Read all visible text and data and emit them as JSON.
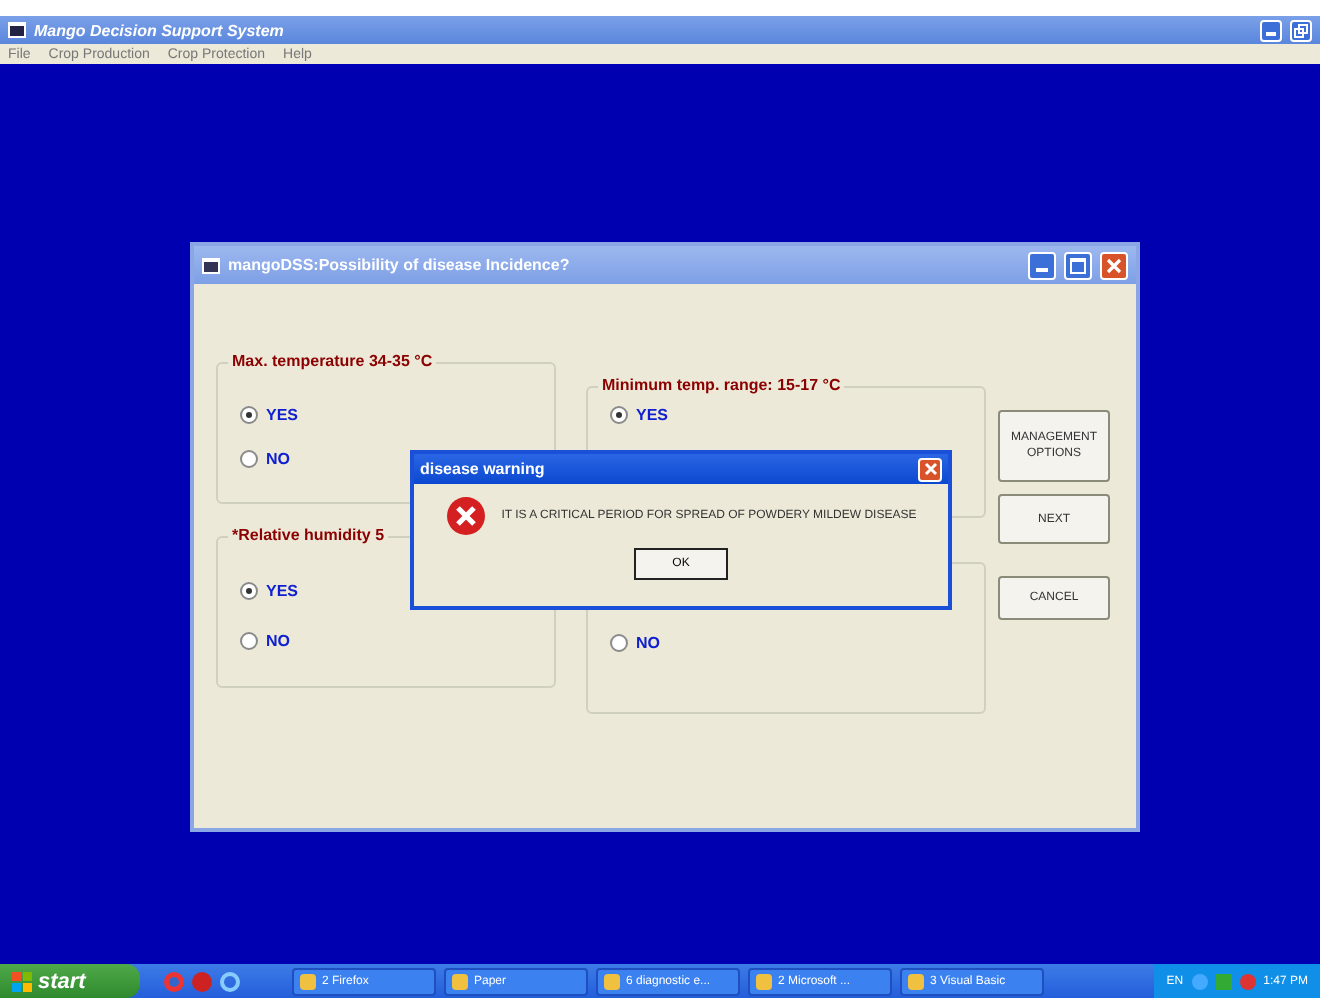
{
  "main_window": {
    "title": "Mango Decision Support System",
    "menu": [
      "File",
      "Crop Production",
      "Crop Protection",
      "Help"
    ]
  },
  "dialog": {
    "title": "mangoDSS:Possibility of disease Incidence?",
    "groups": [
      {
        "title": "Max. temperature 34-35 °C",
        "options": [
          {
            "label": "YES",
            "selected": true
          },
          {
            "label": "NO",
            "selected": false
          }
        ]
      },
      {
        "title": "*Relative humidity 5",
        "options": [
          {
            "label": "YES",
            "selected": true
          },
          {
            "label": "NO",
            "selected": false
          }
        ]
      },
      {
        "title": "Minimum temp. range: 15-17 °C",
        "options": [
          {
            "label": "YES",
            "selected": true
          }
        ]
      },
      {
        "options": [
          {
            "label": "NO",
            "selected": false
          }
        ]
      }
    ],
    "buttons": [
      "MANAGEMENT OPTIONS",
      "NEXT",
      "CANCEL"
    ]
  },
  "message_box": {
    "title": "disease warning",
    "message": "IT IS A CRITICAL PERIOD FOR SPREAD OF POWDERY MILDEW DISEASE",
    "button": "OK"
  },
  "taskbar": {
    "start": "start",
    "tasks": [
      {
        "label": "2 Firefox"
      },
      {
        "label": "Paper"
      },
      {
        "label": "6 diagnostic e..."
      },
      {
        "label": "2 Microsoft ..."
      },
      {
        "label": "3 Visual Basic"
      }
    ],
    "language": "EN",
    "clock": "1:47 PM"
  }
}
